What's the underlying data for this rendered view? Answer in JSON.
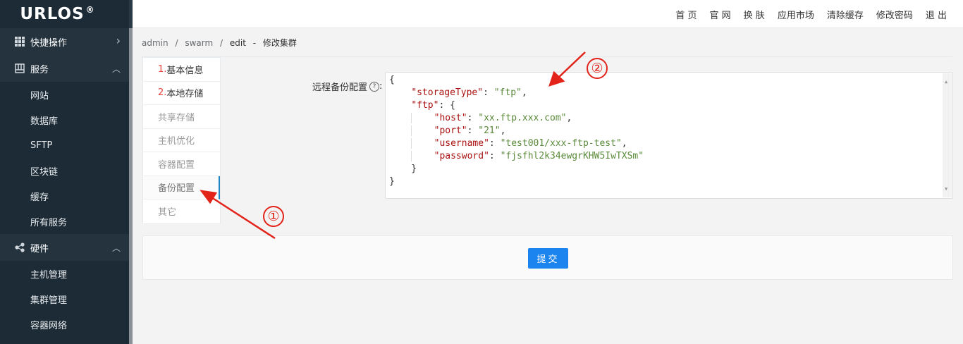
{
  "app": {
    "logo": "URLOS",
    "logo_mark": "®"
  },
  "topnav": {
    "items": [
      "首 页",
      "官 网",
      "换 肤",
      "应用市场",
      "清除缓存",
      "修改密码",
      "退 出"
    ]
  },
  "sidebar": {
    "groups": [
      {
        "label": "快捷操作",
        "icon": "grid-icon",
        "chevron": "›"
      },
      {
        "label": "服务",
        "icon": "service-icon",
        "chevron": "ˆ",
        "items": [
          "网站",
          "数据库",
          "SFTP",
          "区块链",
          "缓存",
          "所有服务"
        ]
      },
      {
        "label": "硬件",
        "icon": "share-nodes-icon",
        "chevron": "ˆ",
        "items": [
          "主机管理",
          "集群管理",
          "容器网络"
        ]
      }
    ]
  },
  "breadcrumb": {
    "items": [
      "admin",
      "/",
      "swarm",
      "/",
      "edit",
      "-",
      "修改集群"
    ]
  },
  "steps": [
    {
      "num": "1.",
      "label": "基本信息",
      "state": "done"
    },
    {
      "num": "2.",
      "label": "本地存储",
      "state": "done"
    },
    {
      "num": "",
      "label": "共享存储",
      "state": "pending"
    },
    {
      "num": "",
      "label": "主机优化",
      "state": "pending"
    },
    {
      "num": "",
      "label": "容器配置",
      "state": "pending"
    },
    {
      "num": "",
      "label": "备份配置",
      "state": "active"
    },
    {
      "num": "",
      "label": "其它",
      "state": "pending"
    }
  ],
  "form": {
    "label": "远程备份配置",
    "help": "?",
    "code": {
      "storageType": "ftp",
      "host": "xx.ftp.xxx.com",
      "port": "21",
      "username": "test001/xxx-ftp-test",
      "password": "fjsfhl2k34ewgrKHW5IwTXSm"
    }
  },
  "submit_label": "提交",
  "annotations": {
    "one": "①",
    "two": "②",
    "color": "#e2231a"
  }
}
